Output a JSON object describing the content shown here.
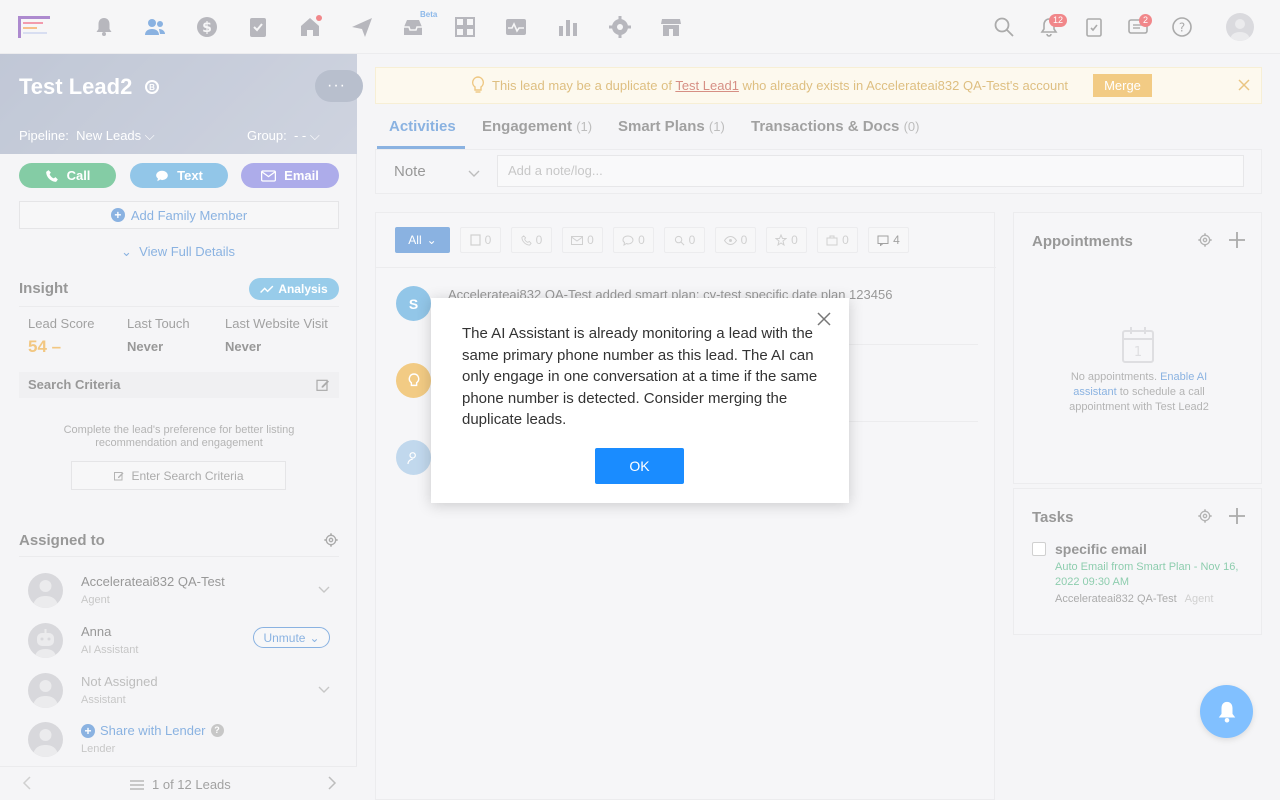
{
  "topnav": {
    "icons": [
      "logo",
      "bell-outline-icon",
      "people-icon",
      "dollar-icon",
      "clipboard-check-icon",
      "home-icon",
      "send-icon",
      "inbox-icon",
      "widgets-icon",
      "pulse-icon",
      "bar-chart-icon",
      "gear-icon",
      "store-icon"
    ],
    "beta_label": "Beta",
    "notifications_count": "12",
    "messages_count": "2"
  },
  "lead": {
    "name": "Test Lead2",
    "badge": "B",
    "pipeline_label": "Pipeline:",
    "pipeline_value": "New Leads",
    "group_label": "Group:",
    "group_value": "- -",
    "more": "···"
  },
  "actions": {
    "call": "Call",
    "text": "Text",
    "email": "Email",
    "add_family": "Add Family Member",
    "view_details": "View Full Details"
  },
  "insight": {
    "title": "Insight",
    "analysis": "Analysis",
    "lead_score_label": "Lead Score",
    "lead_score_value": "54 –",
    "last_touch_label": "Last Touch",
    "last_touch_value": "Never",
    "last_visit_label": "Last Website Visit",
    "last_visit_value": "Never"
  },
  "search_criteria": {
    "title": "Search Criteria",
    "desc": "Complete the lead's preference for better listing recommendation and engagement",
    "button": "Enter Search Criteria"
  },
  "assigned": {
    "title": "Assigned to",
    "people": [
      {
        "name": "Accelerateai832 QA-Test",
        "role": "Agent"
      },
      {
        "name": "Anna",
        "role": "AI Assistant",
        "action": "Unmute"
      },
      {
        "name": "Not Assigned",
        "role": "Assistant"
      },
      {
        "name": "Share with Lender",
        "role": "Lender",
        "help": "?"
      }
    ]
  },
  "pager": {
    "text": "1 of 12 Leads"
  },
  "banner": {
    "prefix": "This lead may be a duplicate of ",
    "link": "Test Lead1",
    "suffix": " who already exists in Accelerateai832 QA-Test's account",
    "merge": "Merge"
  },
  "tabs": [
    {
      "label": "Activities",
      "count": ""
    },
    {
      "label": "Engagement",
      "count": "(1)"
    },
    {
      "label": "Smart Plans",
      "count": "(1)"
    },
    {
      "label": "Transactions & Docs",
      "count": "(0)"
    }
  ],
  "note": {
    "type": "Note",
    "placeholder": "Add a note/log..."
  },
  "filters": {
    "all": "All",
    "chips": [
      {
        "icon": "doc-icon",
        "count": "0"
      },
      {
        "icon": "phone-icon",
        "count": "0"
      },
      {
        "icon": "mail-icon",
        "count": "0"
      },
      {
        "icon": "chat-icon",
        "count": "0"
      },
      {
        "icon": "search-icon",
        "count": "0"
      },
      {
        "icon": "eye-icon",
        "count": "0"
      },
      {
        "icon": "star-icon",
        "count": "0"
      },
      {
        "icon": "briefcase-icon",
        "count": "0"
      },
      {
        "icon": "note-icon",
        "count": "4"
      }
    ]
  },
  "feed": {
    "item1": "Accelerateai832 QA-Test added smart plan: cv-test specific date plan 123456"
  },
  "appointments": {
    "title": "Appointments",
    "cal_day": "1",
    "desc_prefix": "No appointments. ",
    "desc_link": "Enable AI assistant",
    "desc_suffix": " to schedule a call appointment with Test Lead2"
  },
  "tasks": {
    "title": "Tasks",
    "item_title": "specific email",
    "item_sub": "Auto Email from Smart Plan - Nov 16, 2022 09:30 AM",
    "item_assignee": "Accelerateai832 QA-Test",
    "item_role": "Agent"
  },
  "modal": {
    "text": "The AI Assistant is already monitoring a lead with the same primary phone number as this lead. The AI can only engage in one conversation at a time if the same phone number is detected. Consider merging the duplicate leads.",
    "ok": "OK"
  },
  "colors": {
    "accent": "#2a74c9",
    "call": "#20a35c",
    "text": "#3a97d6",
    "email": "#6b68d9",
    "merge": "#e8a11f",
    "ok": "#1a8cff"
  }
}
